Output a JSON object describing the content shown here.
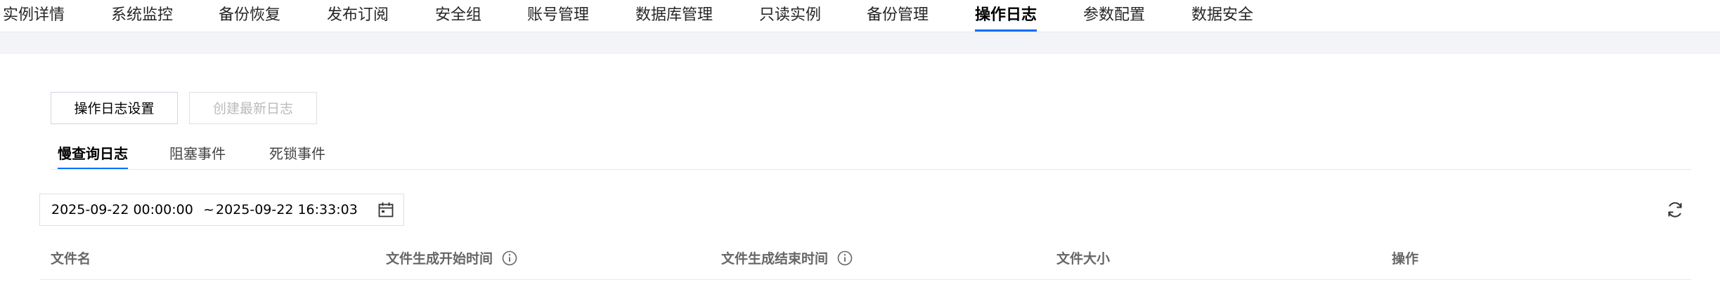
{
  "top_tabs": [
    {
      "label": "实例详情"
    },
    {
      "label": "系统监控"
    },
    {
      "label": "备份恢复"
    },
    {
      "label": "发布订阅"
    },
    {
      "label": "安全组"
    },
    {
      "label": "账号管理"
    },
    {
      "label": "数据库管理"
    },
    {
      "label": "只读实例"
    },
    {
      "label": "备份管理"
    },
    {
      "label": "操作日志",
      "active": true
    },
    {
      "label": "参数配置"
    },
    {
      "label": "数据安全"
    }
  ],
  "toolbar": {
    "settings_label": "操作日志设置",
    "create_label": "创建最新日志"
  },
  "sub_tabs": [
    {
      "label": "慢查询日志",
      "active": true
    },
    {
      "label": "阻塞事件"
    },
    {
      "label": "死锁事件"
    }
  ],
  "date_range": {
    "start": "2025-09-22 00:00:00",
    "separator": "~",
    "end": "2025-09-22 16:33:03"
  },
  "table": {
    "columns": [
      "文件名",
      "文件生成开始时间",
      "文件生成结束时间",
      "文件大小",
      "操作"
    ]
  },
  "icons": {
    "calendar": "calendar-icon",
    "refresh": "refresh-icon",
    "info": "info-icon"
  },
  "colors": {
    "accent": "#006eff",
    "band": "#f3f4f7"
  }
}
